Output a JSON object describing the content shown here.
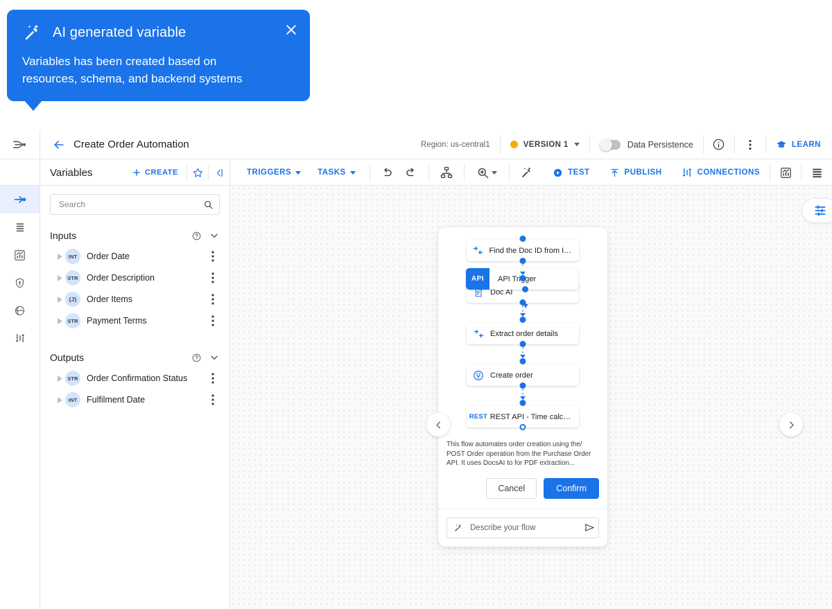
{
  "callout": {
    "icon": "ai-sparkle-icon",
    "title": "AI generated variable",
    "body": "Variables has been created based on resources, schema, and backend systems",
    "close_icon": "close-icon",
    "accent": "#1a73e8"
  },
  "topbar": {
    "brand_icon": "application-integration-logo",
    "back_icon": "arrow-left-icon",
    "title": "Create Order Automation",
    "region": "Region: us-central1",
    "version": {
      "label": "VERSION 1",
      "dot_color": "#f9ab00"
    },
    "data_persistence": {
      "label": "Data Persistence",
      "enabled": false
    },
    "info_icon": "info-circle-icon",
    "more_icon": "more-vert-icon",
    "learn": {
      "label": "LEARN",
      "icon": "school-icon"
    }
  },
  "panel_header": {
    "title": "Variables",
    "create_label": "CREATE",
    "create_icon": "plus-icon",
    "star_icon": "star-outline-icon",
    "collapse_icon": "collapse-panel-icon"
  },
  "toolbar": {
    "triggers_label": "TRIGGERS",
    "tasks_label": "TASKS",
    "undo_icon": "undo-icon",
    "redo_icon": "redo-icon",
    "layout_icon": "auto-layout-icon",
    "zoom_icon": "zoom-in-icon",
    "magic_icon": "ai-sparkle-icon",
    "test_label": "TEST",
    "test_icon": "play-circle-icon",
    "publish_label": "PUBLISH",
    "publish_icon": "publish-icon",
    "connections_label": "CONNECTIONS",
    "connections_icon": "connections-icon",
    "analytics_icon": "analytics-icon",
    "logs_icon": "logs-icon"
  },
  "rail": {
    "items": [
      {
        "icon": "variables-icon",
        "name": "variables",
        "active": true
      },
      {
        "icon": "logs-icon",
        "name": "logs",
        "active": false
      },
      {
        "icon": "analytics-icon",
        "name": "analytics",
        "active": false
      },
      {
        "icon": "security-shield-icon",
        "name": "security",
        "active": false
      },
      {
        "icon": "globe-icon",
        "name": "region",
        "active": false
      },
      {
        "icon": "connections-icon",
        "name": "connections",
        "active": false
      }
    ]
  },
  "search": {
    "placeholder": "Search",
    "value": "",
    "icon": "search-icon"
  },
  "variables": {
    "groups": [
      {
        "title": "Inputs",
        "help_icon": "help-circle-icon",
        "collapse_icon": "chevron-down-icon",
        "items": [
          {
            "type": "INT",
            "name": "Order Date"
          },
          {
            "type": "STR",
            "name": "Order Description"
          },
          {
            "type": "{J}",
            "name": "Order Items"
          },
          {
            "type": "STR",
            "name": "Payment Terms"
          }
        ]
      },
      {
        "title": "Outputs",
        "help_icon": "help-circle-icon",
        "collapse_icon": "chevron-down-icon",
        "items": [
          {
            "type": "STR",
            "name": "Order Confirmation Status"
          },
          {
            "type": "INT",
            "name": "Fulfilment Date"
          }
        ]
      }
    ]
  },
  "canvas": {
    "filter_icon": "tune-icon",
    "nav_prev_icon": "chevron-left-icon",
    "nav_next_icon": "chevron-right-icon",
    "trigger": {
      "badge": "API",
      "label": "API Trigger"
    },
    "nodes": [
      {
        "icon": "mapping-icon",
        "label": "Find the Doc ID from Input"
      },
      {
        "icon": "doc-ai-icon",
        "label": "Doc AI"
      },
      {
        "icon": "mapping-icon",
        "label": "Extract order details"
      },
      {
        "icon": "connector-icon",
        "label": "Create order"
      },
      {
        "icon": "rest-badge",
        "label": "REST API - Time calcul..."
      }
    ],
    "description": "This flow automates order creation using the/ POST Order operation from the Purchase Order API. It uses DocsAI to for PDF extraction...",
    "cancel_label": "Cancel",
    "confirm_label": "Confirm",
    "prompt": {
      "placeholder": "Describe your flow",
      "value": "",
      "icon": "ai-sparkle-icon",
      "send_icon": "send-icon"
    }
  }
}
